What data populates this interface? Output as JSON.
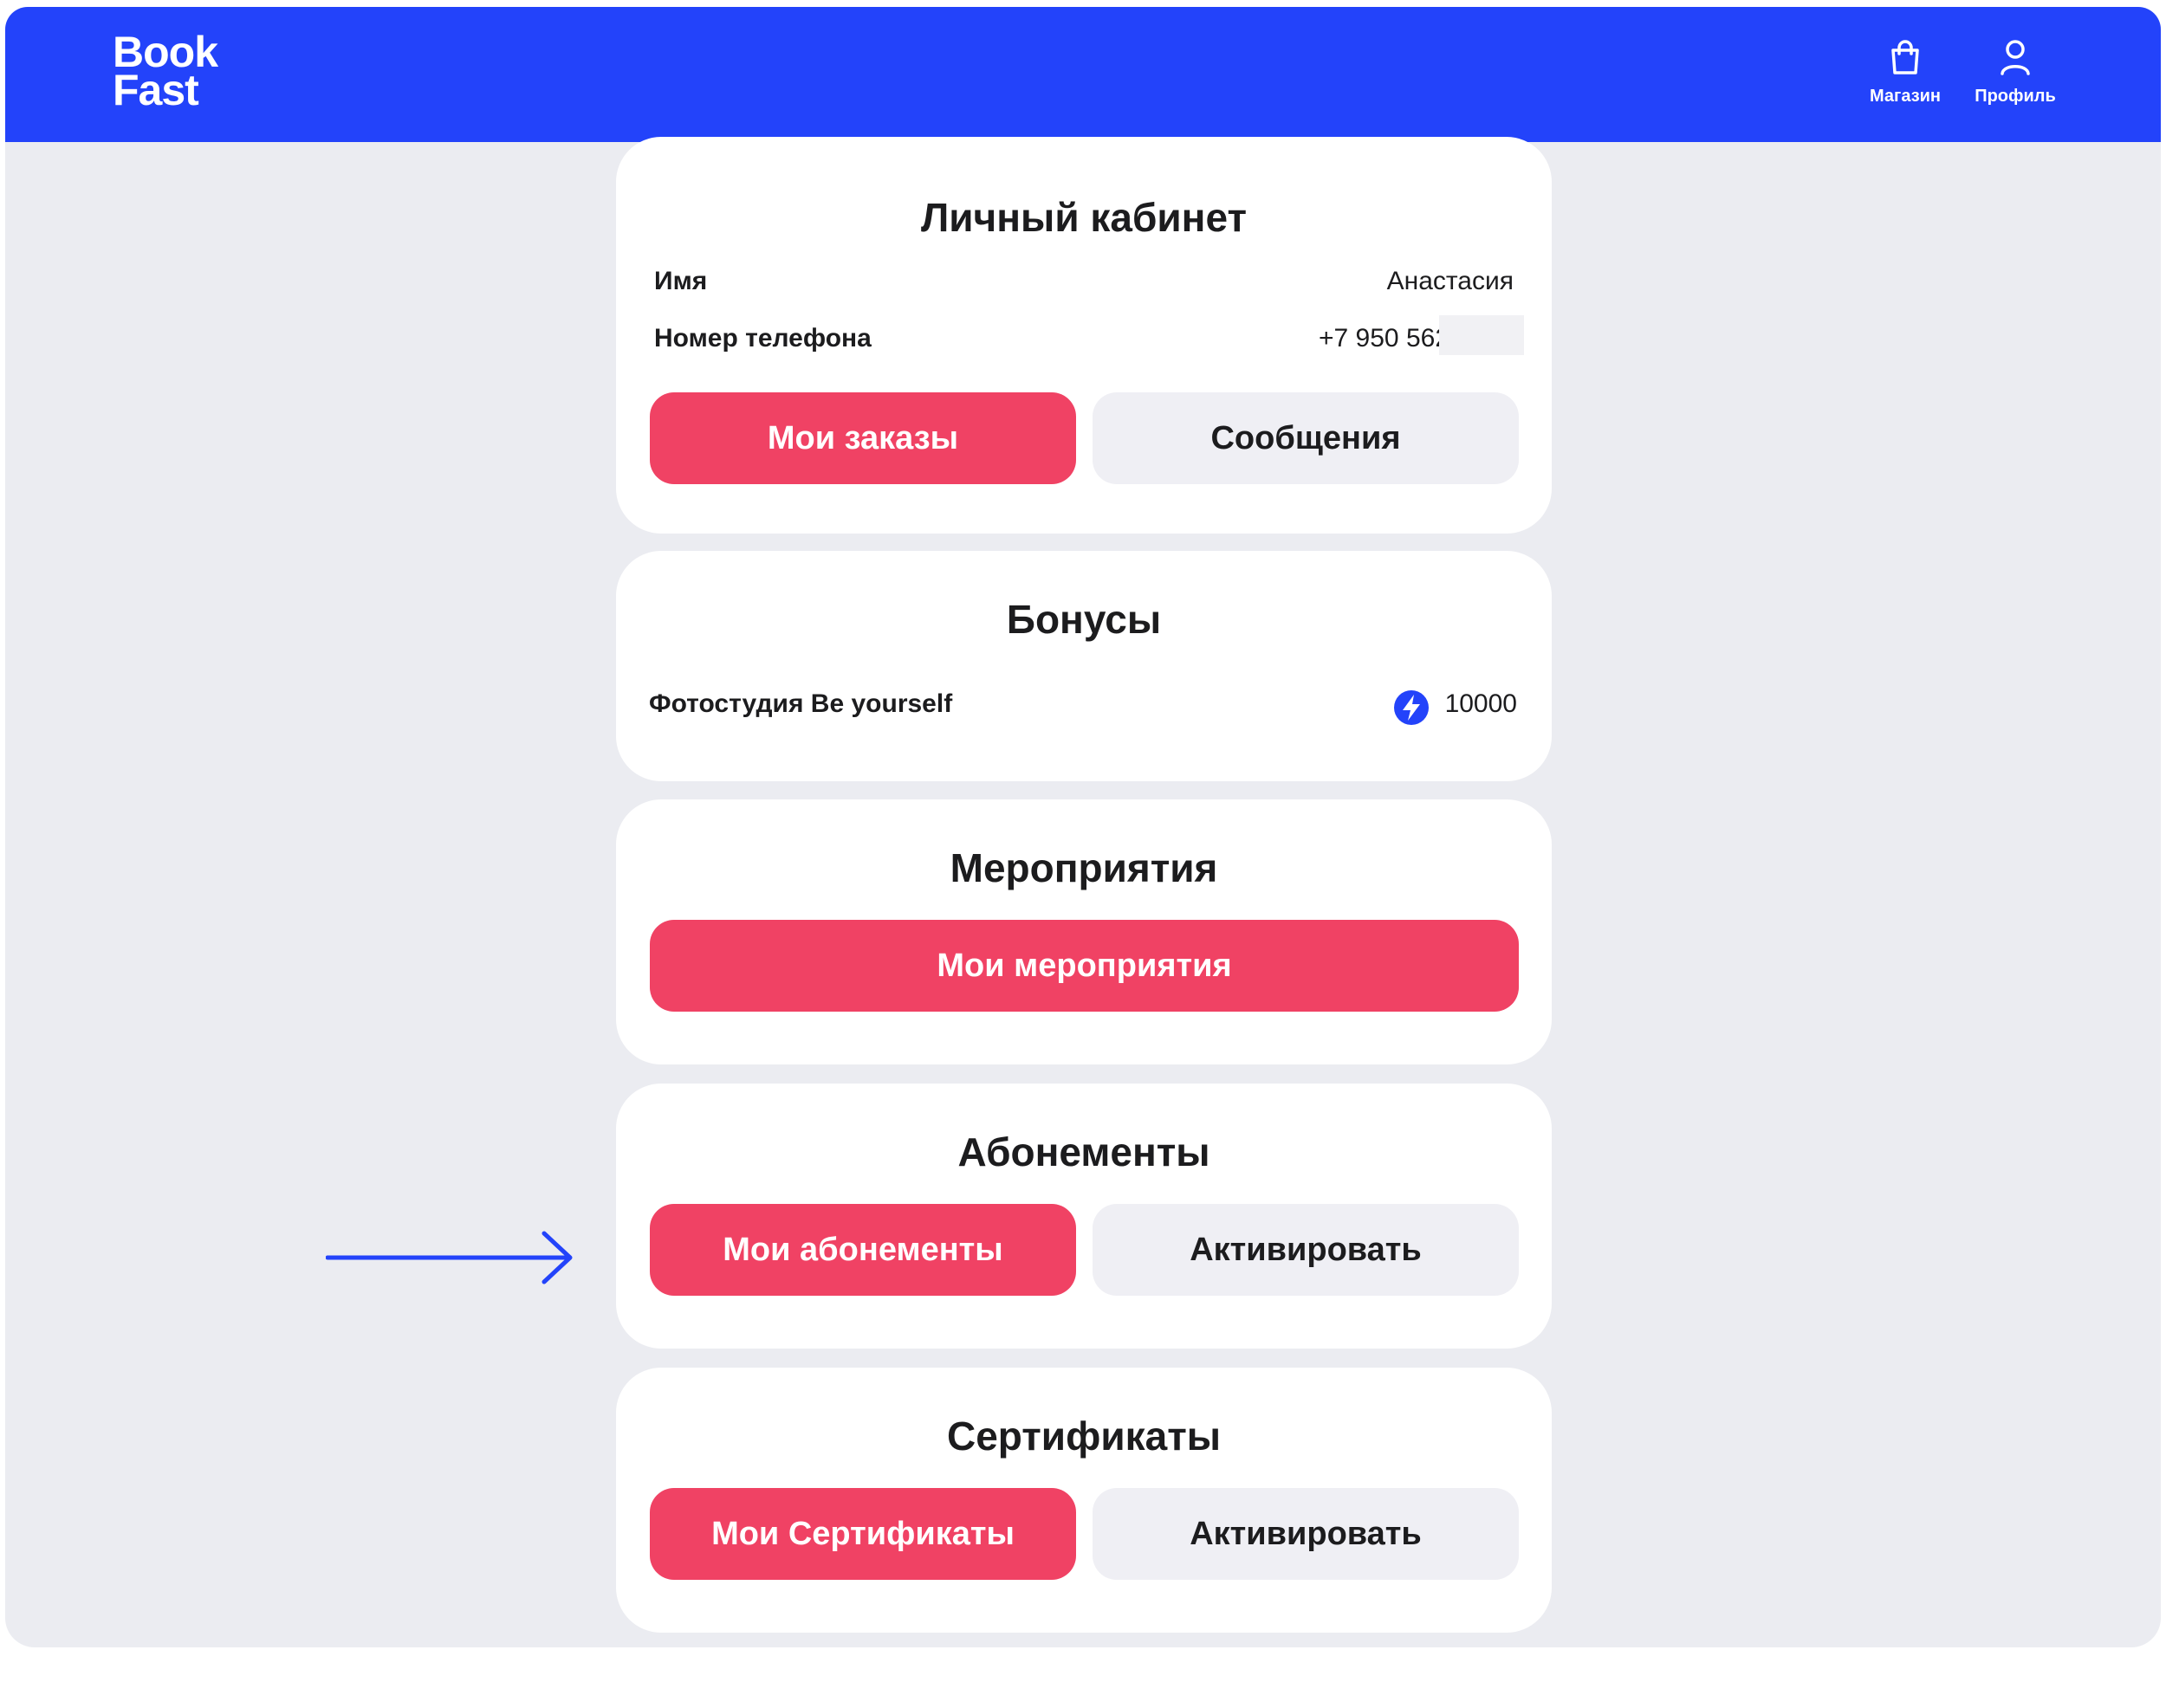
{
  "brand": {
    "line1": "Book",
    "line2": "Fast",
    "primary_color": "#2343fa"
  },
  "nav": {
    "shop_label": "Магазин",
    "profile_label": "Профиль"
  },
  "account": {
    "title": "Личный кабинет",
    "name_label": "Имя",
    "name_value": "Анастасия",
    "phone_label": "Номер телефона",
    "phone_value": "+7 950 562",
    "orders_button": "Мои заказы",
    "messages_button": "Сообщения"
  },
  "bonuses": {
    "title": "Бонусы",
    "studio_name": "Фотостудия Be yourself",
    "amount": "10000",
    "icon": "bolt-icon"
  },
  "events": {
    "title": "Мероприятия",
    "my_events_button": "Мои мероприятия"
  },
  "subscriptions": {
    "title": "Абонементы",
    "my_subscriptions_button": "Мои абонементы",
    "activate_button": "Активировать"
  },
  "certificates": {
    "title": "Сертификаты",
    "my_certificates_button": "Мои Сертификаты",
    "activate_button": "Активировать"
  },
  "colors": {
    "accent_pink": "#f04264",
    "page_background": "#ebecf1",
    "secondary_button": "#efeff4"
  }
}
